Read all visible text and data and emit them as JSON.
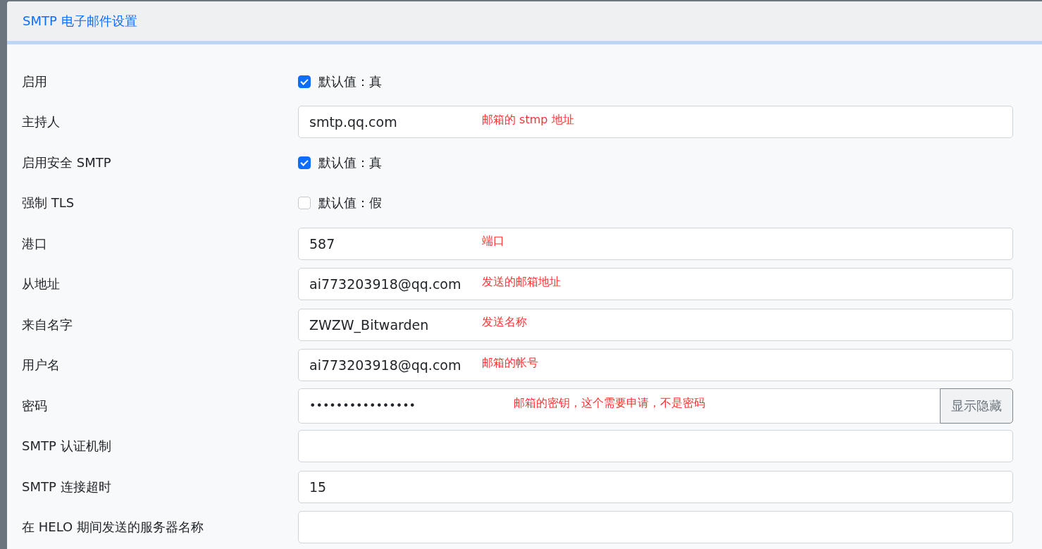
{
  "panel": {
    "title": "SMTP 电子邮件设置"
  },
  "settings": [
    {
      "label": "启用",
      "kind": "checkbox",
      "checked": true,
      "text": "默认值：真"
    },
    {
      "label": "主持人",
      "kind": "text",
      "value": "smtp.qq.com",
      "note": "邮箱的 stmp 地址"
    },
    {
      "label": "启用安全 SMTP",
      "kind": "checkbox",
      "checked": true,
      "text": "默认值：真"
    },
    {
      "label": "强制 TLS",
      "kind": "checkbox",
      "checked": false,
      "text": "默认值：假"
    },
    {
      "label": "港口",
      "kind": "text",
      "value": "587",
      "note": "端口"
    },
    {
      "label": "从地址",
      "kind": "text",
      "value": "ai773203918@qq.com",
      "note": "发送的邮箱地址"
    },
    {
      "label": "来自名字",
      "kind": "text",
      "value": "ZWZW_Bitwarden",
      "note": "发送名称"
    },
    {
      "label": "用户名",
      "kind": "text",
      "value": "ai773203918@qq.com",
      "note": "邮箱的帐号"
    },
    {
      "label": "密码",
      "kind": "password",
      "value": "••••••••••••••••",
      "note": "邮箱的密钥，这个需要申请，不是密码",
      "button": "显示隐藏"
    },
    {
      "label": "SMTP 认证机制",
      "kind": "text"
    },
    {
      "label": "SMTP 连接超时",
      "kind": "text",
      "value": "15"
    },
    {
      "label": "在 HELO 期间发送的服务器名称",
      "kind": "text"
    }
  ]
}
